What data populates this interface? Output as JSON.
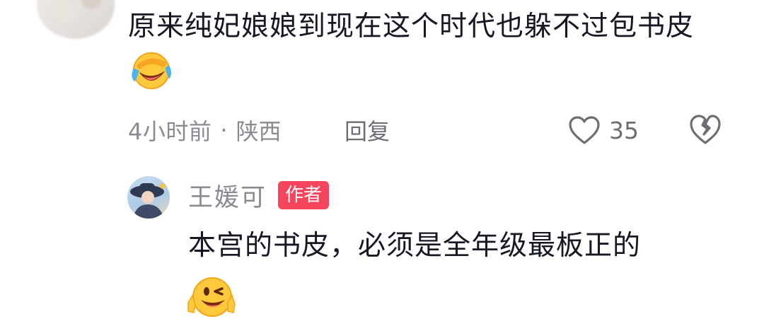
{
  "comment": {
    "text": "原来纯妃娘娘到现在这个时代也躲不过包书皮",
    "emoji": "laughing-crying-emoji",
    "time": "4小时前",
    "separator": "·",
    "location": "陕西",
    "reply_label": "回复",
    "like_count": "35"
  },
  "reply": {
    "author_name": "王媛可",
    "author_badge": "作者",
    "text": "本宫的书皮，必须是全年级最板正的",
    "emoji": "wink-peace-emoji"
  },
  "colors": {
    "badge_bg": "#f5455c",
    "meta_text": "#8a8b91",
    "main_text": "#161823"
  }
}
